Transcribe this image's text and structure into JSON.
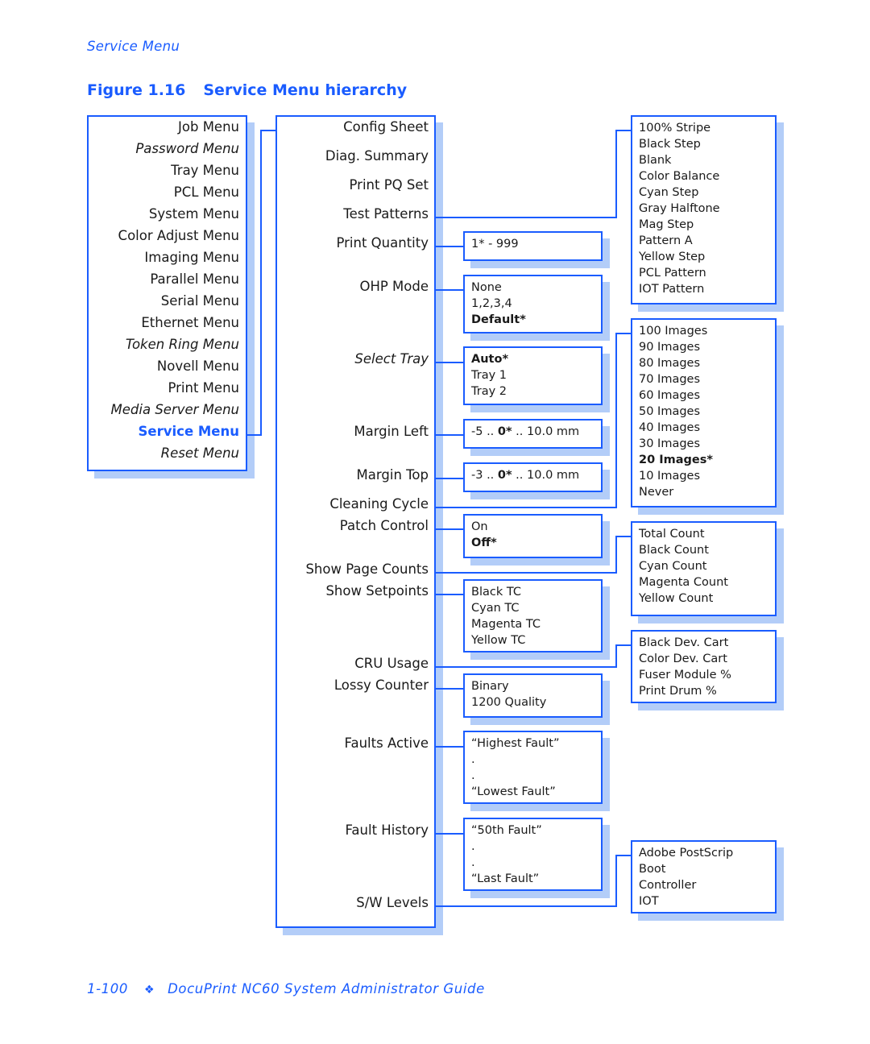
{
  "header": {
    "running_title": "Service Menu"
  },
  "figure": {
    "number": "Figure 1.16",
    "title": "Service Menu hierarchy"
  },
  "colors": {
    "accent": "#1a5cff",
    "shadow": "#b3cdf8",
    "text": "#1a1a1a"
  },
  "top_menus": [
    {
      "label": "Job Menu",
      "style": "normal"
    },
    {
      "label": "Password Menu",
      "style": "italic"
    },
    {
      "label": "Tray Menu",
      "style": "normal"
    },
    {
      "label": "PCL Menu",
      "style": "normal"
    },
    {
      "label": "System Menu",
      "style": "normal"
    },
    {
      "label": "Color Adjust Menu",
      "style": "normal"
    },
    {
      "label": "Imaging Menu",
      "style": "normal"
    },
    {
      "label": "Parallel Menu",
      "style": "normal"
    },
    {
      "label": "Serial Menu",
      "style": "normal"
    },
    {
      "label": "Ethernet Menu",
      "style": "normal"
    },
    {
      "label": "Token Ring Menu",
      "style": "italic"
    },
    {
      "label": "Novell Menu",
      "style": "normal"
    },
    {
      "label": "Print Menu",
      "style": "normal"
    },
    {
      "label": "Media Server Menu",
      "style": "italic"
    },
    {
      "label": "Service Menu",
      "style": "active"
    },
    {
      "label": "Reset Menu",
      "style": "italic"
    }
  ],
  "service_items": [
    {
      "label": "Config Sheet",
      "style": "normal"
    },
    {
      "label": "Diag. Summary",
      "style": "normal"
    },
    {
      "label": "Print PQ Set",
      "style": "normal"
    },
    {
      "label": "Test Patterns",
      "style": "normal"
    },
    {
      "label": "Print Quantity",
      "style": "normal"
    },
    {
      "label": "OHP Mode",
      "style": "normal"
    },
    {
      "label": "Select Tray",
      "style": "italic"
    },
    {
      "label": "Margin Left",
      "style": "normal"
    },
    {
      "label": "Margin Top",
      "style": "normal"
    },
    {
      "label": "Cleaning Cycle",
      "style": "normal"
    },
    {
      "label": "Patch Control",
      "style": "normal"
    },
    {
      "label": "Show Page Counts",
      "style": "normal"
    },
    {
      "label": "Show Setpoints",
      "style": "normal"
    },
    {
      "label": "CRU Usage",
      "style": "normal"
    },
    {
      "label": "Lossy Counter",
      "style": "normal"
    },
    {
      "label": "Faults Active",
      "style": "normal"
    },
    {
      "label": "Fault History",
      "style": "normal"
    },
    {
      "label": "S/W Levels",
      "style": "normal"
    }
  ],
  "value_boxes": {
    "print_quantity": [
      {
        "text": "1* - 999"
      }
    ],
    "ohp_mode": [
      {
        "text": "None"
      },
      {
        "text": "1,2,3,4"
      },
      {
        "text": "Default*",
        "bold": true
      }
    ],
    "select_tray": [
      {
        "text": "Auto*",
        "bold": true
      },
      {
        "text": "Tray 1"
      },
      {
        "text": "Tray 2"
      }
    ],
    "margin_left": {
      "min": "-5",
      "sep1": " .. ",
      "default": "0*",
      "sep2": " .. ",
      "max": "10.0 mm"
    },
    "margin_top": {
      "min": "-3",
      "sep1": " .. ",
      "default": "0*",
      "sep2": " .. ",
      "max": "10.0 mm"
    },
    "patch_control": [
      {
        "text": "On"
      },
      {
        "text": "Off*",
        "bold": true
      }
    ],
    "show_setpoints": [
      {
        "text": "Black TC"
      },
      {
        "text": "Cyan TC"
      },
      {
        "text": "Magenta TC"
      },
      {
        "text": "Yellow TC"
      }
    ],
    "lossy_counter": [
      {
        "text": "Binary"
      },
      {
        "text": "1200 Quality"
      }
    ],
    "faults_active": [
      {
        "text": "“Highest Fault”"
      },
      {
        "text": "."
      },
      {
        "text": "."
      },
      {
        "text": "“Lowest Fault”"
      }
    ],
    "fault_history": [
      {
        "text": "“50th Fault”"
      },
      {
        "text": "."
      },
      {
        "text": "."
      },
      {
        "text": "“Last Fault”"
      }
    ]
  },
  "right_boxes": {
    "test_patterns": [
      {
        "text": "100% Stripe"
      },
      {
        "text": "Black Step"
      },
      {
        "text": "Blank"
      },
      {
        "text": "Color Balance"
      },
      {
        "text": "Cyan Step"
      },
      {
        "text": "Gray Halftone"
      },
      {
        "text": "Mag Step"
      },
      {
        "text": "Pattern A"
      },
      {
        "text": "Yellow Step"
      },
      {
        "text": "PCL Pattern"
      },
      {
        "text": "IOT Pattern"
      }
    ],
    "cleaning_cycle": [
      {
        "text": "100 Images"
      },
      {
        "text": "90 Images"
      },
      {
        "text": "80 Images"
      },
      {
        "text": "70 Images"
      },
      {
        "text": "60 Images"
      },
      {
        "text": "50 Images"
      },
      {
        "text": "40 Images"
      },
      {
        "text": "30 Images"
      },
      {
        "text": "20 Images*",
        "bold": true
      },
      {
        "text": "10 Images"
      },
      {
        "text": "Never"
      }
    ],
    "show_page_counts": [
      {
        "text": "Total Count"
      },
      {
        "text": "Black Count"
      },
      {
        "text": "Cyan Count"
      },
      {
        "text": "Magenta Count"
      },
      {
        "text": "Yellow Count"
      }
    ],
    "cru_usage": [
      {
        "text": "Black Dev. Cart"
      },
      {
        "text": "Color Dev. Cart"
      },
      {
        "text": "Fuser Module %"
      },
      {
        "text": "Print Drum %"
      }
    ],
    "sw_levels": [
      {
        "text": "Adobe PostScrip"
      },
      {
        "text": "Boot"
      },
      {
        "text": "Controller"
      },
      {
        "text": "IOT"
      }
    ]
  },
  "footer": {
    "page": "1-100",
    "separator": "❖",
    "doc_title": "DocuPrint NC60 System Administrator Guide"
  }
}
